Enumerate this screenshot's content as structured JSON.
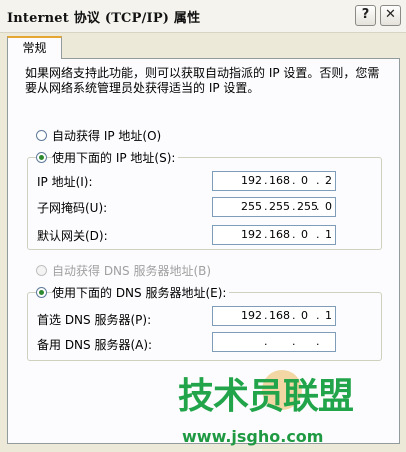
{
  "window": {
    "title": "Internet 协议 (TCP/IP) 属性",
    "help_button": "?",
    "close_button": "✕"
  },
  "tabs": [
    {
      "label": "常规"
    }
  ],
  "description": "如果网络支持此功能，则可以获取自动指派的 IP 设置。否则，您需要从网络系统管理员处获得适当的 IP 设置。",
  "ip_section": {
    "auto_option": "自动获得 IP 地址(O)",
    "manual_option": "使用下面的 IP 地址(S):",
    "selected": "manual",
    "fields": [
      {
        "label": "IP 地址(I):",
        "octets": [
          "192",
          "168",
          "0",
          "2"
        ]
      },
      {
        "label": "子网掩码(U):",
        "octets": [
          "255",
          "255",
          "255",
          "0"
        ]
      },
      {
        "label": "默认网关(D):",
        "octets": [
          "192",
          "168",
          "0",
          "1"
        ]
      }
    ]
  },
  "dns_section": {
    "auto_option": "自动获得 DNS 服务器地址(B)",
    "auto_enabled": false,
    "manual_option": "使用下面的 DNS 服务器地址(E):",
    "selected": "manual",
    "fields": [
      {
        "label": "首选 DNS 服务器(P):",
        "octets": [
          "192",
          "168",
          "0",
          "1"
        ]
      },
      {
        "label": "备用 DNS 服务器(A):",
        "octets": [
          "",
          "",
          "",
          ""
        ]
      }
    ]
  },
  "watermark": {
    "text": "技术员联盟",
    "url": "www.jsgho.com"
  }
}
